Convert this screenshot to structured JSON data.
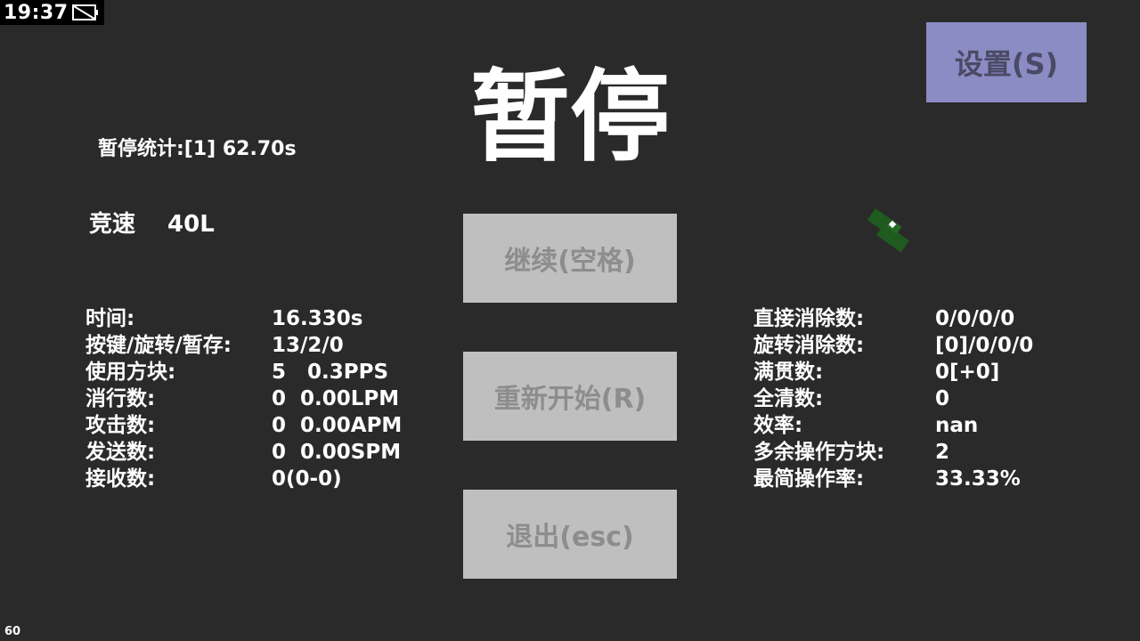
{
  "status_bar": {
    "time": "19:37",
    "battery_icon": "battery-icon"
  },
  "settings_button": {
    "label": "设置(S)"
  },
  "title": "暂停",
  "pause_stats": "暂停统计:[1] 62.70s",
  "mode": {
    "name": "竞速",
    "level": "40L"
  },
  "buttons": {
    "resume": "继续(空格)",
    "restart": "重新开始(R)",
    "exit": "退出(esc)"
  },
  "left_stats": [
    {
      "label": "时间:",
      "value": "16.330s"
    },
    {
      "label": "按键/旋转/暂存:",
      "value": "13/2/0"
    },
    {
      "label": "使用方块:",
      "value": "5   0.3PPS"
    },
    {
      "label": "消行数:",
      "value": "0  0.00LPM"
    },
    {
      "label": "攻击数:",
      "value": "0  0.00APM"
    },
    {
      "label": "发送数:",
      "value": "0  0.00SPM"
    },
    {
      "label": "接收数:",
      "value": "0(0-0)"
    }
  ],
  "right_stats": [
    {
      "label": "直接消除数:",
      "value": "0/0/0/0"
    },
    {
      "label": "旋转消除数:",
      "value": "[0]/0/0/0"
    },
    {
      "label": "满贯数:",
      "value": "0[+0]"
    },
    {
      "label": "全清数:",
      "value": "0"
    },
    {
      "label": "效率:",
      "value": "nan"
    },
    {
      "label": "多余操作方块:",
      "value": "2"
    },
    {
      "label": "最简操作率:",
      "value": "33.33%"
    }
  ],
  "fps": "60",
  "colors": {
    "background": "#2a2a2a",
    "settings_button": "#8c8cc4",
    "menu_button": "#bfbfbf",
    "menu_button_text": "#8d8d8d",
    "piece_green": "#1f5a1f"
  }
}
